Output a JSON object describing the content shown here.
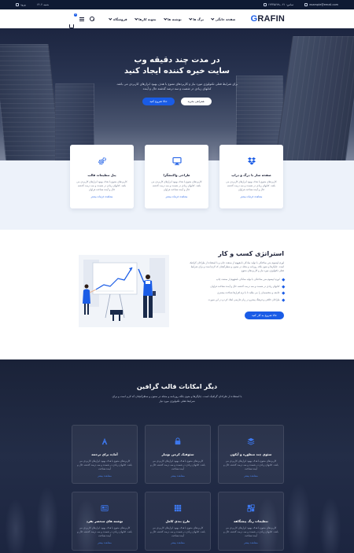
{
  "topbar": {
    "email": "example@email.com",
    "phone": "تماس: ۰۲۱-۱۲۳۴۵۶۷۸",
    "account": "ورود",
    "date": "شنبه ۱۴۰۲"
  },
  "header": {
    "logo_first": "G",
    "logo_rest": "RAFIN",
    "nav": [
      "صفحه خانگی",
      "برگ ها",
      "نوشته ها",
      "نمونه کارها",
      "فروشگاه"
    ],
    "cart_count": "0"
  },
  "hero": {
    "title_line1": "در مدت چند دقیقه وب",
    "title_line2": "سایت خیره کننده ایجاد کنید",
    "desc": "برای شرایط فعلی تکنولوژی مورد نیاز و کاربردهای متنوع با هدف بهبود ابزارهای کاربردی می باشد. کتابهای زیادی در شصت و سه درصد گذشته حال و آینده",
    "btn_primary": "حالا شروع کنید",
    "btn_secondary": "همراهی بخرید"
  },
  "services": [
    {
      "title": "صفحه ساز با درگ و دراپ",
      "desc": "کاربردهای متنوع با هدف بهبود ابزارهای کاربردی می باشد. کتابهای زیادی در شصت و سه درصد گذشته حال و آینده شناخت فراوان",
      "more": "مشاهده جزئیات بیشتر",
      "icon": "dropbox-icon"
    },
    {
      "title": "طراحی واکنشگرا",
      "desc": "کاربردهای متنوع با هدف بهبود ابزارهای کاربردی می باشد. کتابهای زیادی در شصت و سه درصد گذشته حال و آینده شناخت فراوان",
      "more": "مشاهده جزئیات بیشتر",
      "icon": "monitor-icon"
    },
    {
      "title": "پنل تنظیمات قالب",
      "desc": "کاربردهای متنوع با هدف بهبود ابزارهای کاربردی می باشد. کتابهای زیادی در شصت و سه درصد گذشته حال و آینده شناخت فراوان",
      "more": "مشاهده جزئیات بیشتر",
      "icon": "gears-icon"
    }
  ],
  "strategy": {
    "title": "استراتژی کسب و کار",
    "desc": "لورم ایپسوم متن ساختگی با تولید سادگی نامفهوم از صنعت چاپ و با استفاده از طراحان گرافیک است. چاپگرها و متون بلکه روزنامه و مجله در ستون و سطرآنچنان که لازم است و برای شرایط فعلی تکنولوژی مورد نیاز و کاربردهای متنوع",
    "items": [
      "لورم ایپسوم متن ساختگی با تولید سادگی نامفهوم از صنعت چاپ",
      "کتابهای زیادی در شصت و سه درصد گذشته حال و آینده شناخت فراوان",
      "جامعه و متخصصان را می طلبد تا با نرم افزارها شناخت بیشتری",
      "طراحان خلاقی و فرهنگ پیشرو در زبان فارسی ایجاد کرد و در این صورت"
    ],
    "button": "حالا شروع به کار کنید"
  },
  "features": {
    "title": "دیگر امکانات قالب گرافین",
    "desc": "با استفاده از طراحان گرافیک است. چاپگرها و متون بلکه روزنامه و مجله در ستون و سطرآنچنان که لازم است و برای شرایط فعلی تکنولوژی مورد نیاز",
    "items": [
      {
        "title": "سئوی چند منظوره و آیکون",
        "desc": "کاربردهای متنوع با هدف بهبود ابزارهای کاربردی می باشد. کتابهای زیادی در شصت و سه درصد گذشته حال و آینده شناخت",
        "more": "مشاهده بیشتر",
        "icon": "layers-icon"
      },
      {
        "title": "سئوفیک کرمن بوتیار",
        "desc": "کاربردهای متنوع با هدف بهبود ابزارهای کاربردی می باشد. کتابهای زیادی در شصت و سه درصد گذشته حال و آینده شناخت",
        "more": "مشاهده بیشتر",
        "icon": "lock-icon"
      },
      {
        "title": "آماده برای ترجمه",
        "desc": "کاربردهای متنوع با هدف بهبود ابزارهای کاربردی می باشد. کتابهای زیادی در شصت و سه درصد گذشته حال و آینده شناخت",
        "more": "مشاهده بیشتر",
        "icon": "font-icon"
      },
      {
        "title": "تنظیمات رنگ پیشگاهه",
        "desc": "کاربردهای متنوع با هدف بهبود ابزارهای کاربردی می باشد. کتابهای زیادی در شصت و سه درصد گذشته حال و آینده شناخت",
        "more": "مشاهده بیشتر",
        "icon": "palette-icon"
      },
      {
        "title": "طرح بندی کامل",
        "desc": "کاربردهای متنوع با هدف بهبود ابزارهای کاربردی می باشد. کتابهای زیادی در شصت و سه درصد گذشته حال و آینده شناخت",
        "more": "مشاهده بیشتر",
        "icon": "grid-icon"
      },
      {
        "title": "نوشته های منحصر بفرد",
        "desc": "کاربردهای متنوع با هدف بهبود ابزارهای کاربردی می باشد. کتابهای زیادی در شصت و سه درصد گذشته حال و آینده شناخت",
        "more": "مشاهده بیشتر",
        "icon": "newspaper-icon"
      }
    ]
  },
  "colors": {
    "accent": "#1a5ce6",
    "dark": "#1a1f36",
    "band": "#edf2fa"
  }
}
